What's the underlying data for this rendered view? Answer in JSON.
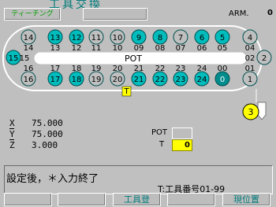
{
  "header": {
    "title": "工具交換",
    "teaching_button": "ティーチング",
    "blank_button": "",
    "arm_label": "ARM.",
    "arm_value": "0"
  },
  "magazine": {
    "pot_label": "POT",
    "top_pocket_numbers": [
      "14",
      "13",
      "12",
      "11",
      "10",
      "9",
      "8",
      "7",
      "6",
      "5",
      "4"
    ],
    "bottom_pocket_numbers": [
      "16",
      "17",
      "18",
      "19",
      "20",
      "21",
      "22",
      "23",
      "24",
      "0",
      "1"
    ],
    "top_slot_labels": [
      "14",
      "13",
      "12",
      "11",
      "10",
      "09",
      "08",
      "07",
      "06",
      "05",
      "04"
    ],
    "bottom_slot_labels": [
      "16",
      "17",
      "18",
      "19",
      "20",
      "21",
      "22",
      "23",
      "24",
      "00",
      "01"
    ],
    "left_pocket": "15",
    "left_slot_label": "15",
    "right_pocket_number": "2",
    "right_slot_label": "02",
    "spindle_tool": "3",
    "marker": "T"
  },
  "position": {
    "x_label": "X",
    "x_value": "75.000",
    "y_label": "Y",
    "y_value": "75.000",
    "z_label": "Z",
    "z_value": "3.000"
  },
  "inputs": {
    "pot_label": "POT",
    "pot_value": "",
    "t_label": "T",
    "t_value": "0"
  },
  "status": {
    "message": "設定後，＊入力終了",
    "hint": "T:工具番号01-99"
  },
  "function_keys": [
    "",
    "",
    "工具登",
    "",
    "現位置"
  ],
  "colors": {
    "background": "#bfbfbf",
    "pocket_cyan": "#00bcbc",
    "pocket_dark": "#008c8c",
    "tool_yellow": "#ffff00",
    "label_green": "#00a000"
  }
}
